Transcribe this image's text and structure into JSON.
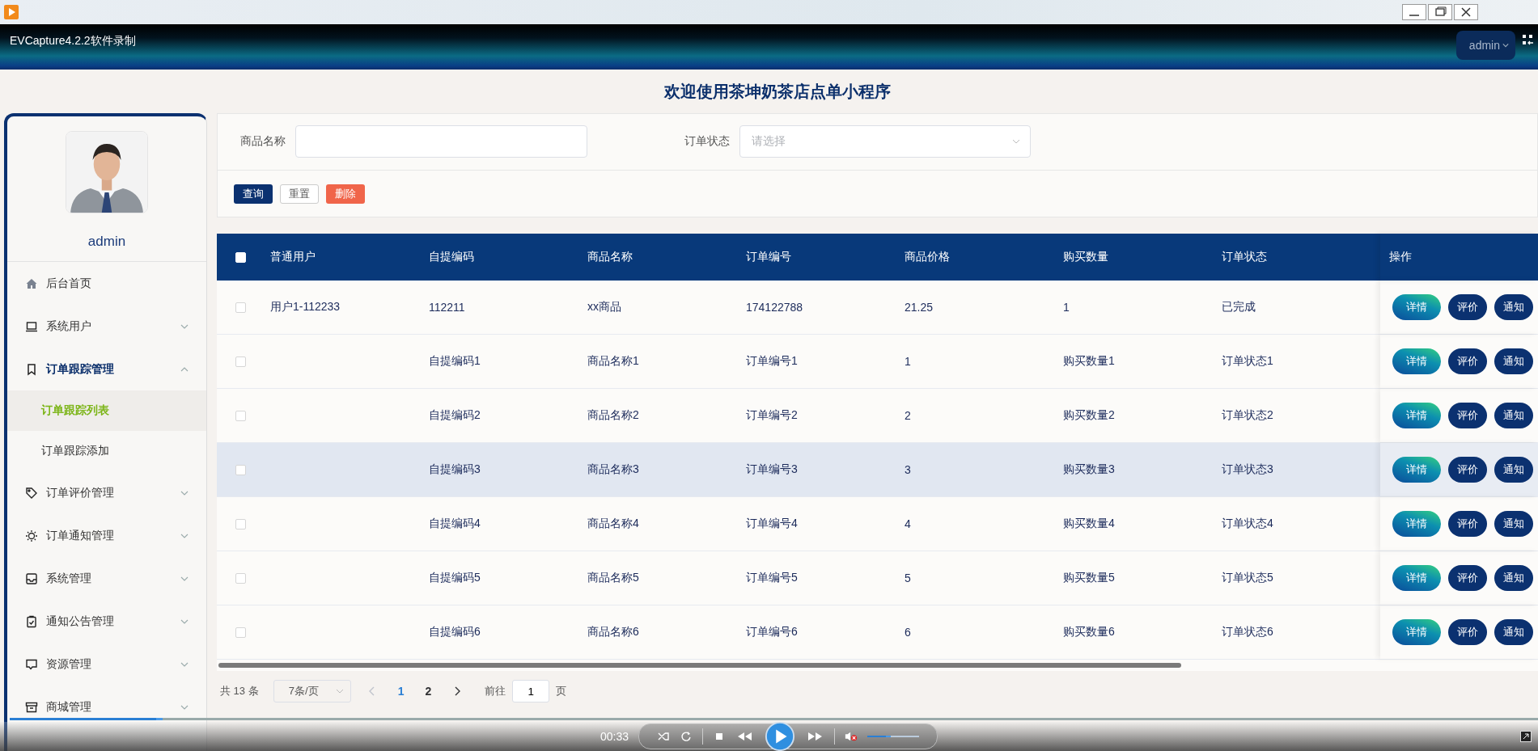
{
  "app_window": {
    "title": "EVCapture4.2.2软件录制"
  },
  "header": {
    "user_menu": "admin"
  },
  "page_title": "欢迎使用茶坤奶茶店点单小程序",
  "sidebar": {
    "username": "admin",
    "items": [
      {
        "label": "后台首页",
        "kind": "link",
        "selected": false
      },
      {
        "label": "系统用户",
        "kind": "group",
        "selected": false,
        "expanded": false
      },
      {
        "label": "订单跟踪管理",
        "kind": "group",
        "selected": true,
        "expanded": true,
        "children": [
          {
            "label": "订单跟踪列表",
            "selected": true
          },
          {
            "label": "订单跟踪添加",
            "selected": false
          }
        ]
      },
      {
        "label": "订单评价管理",
        "kind": "group",
        "selected": false,
        "expanded": false
      },
      {
        "label": "订单通知管理",
        "kind": "group",
        "selected": false,
        "expanded": false
      },
      {
        "label": "系统管理",
        "kind": "group",
        "selected": false,
        "expanded": false
      },
      {
        "label": "通知公告管理",
        "kind": "group",
        "selected": false,
        "expanded": false
      },
      {
        "label": "资源管理",
        "kind": "group",
        "selected": false,
        "expanded": false
      },
      {
        "label": "商城管理",
        "kind": "group",
        "selected": false,
        "expanded": false
      }
    ]
  },
  "filters": [
    {
      "label": "商品名称",
      "kind": "text"
    },
    {
      "label": "订单状态",
      "kind": "select",
      "placeholder": "请选择"
    }
  ],
  "filter_buttons": [
    {
      "label": "查询",
      "kind": "primary"
    },
    {
      "label": "重置",
      "kind": "plain"
    },
    {
      "label": "删除",
      "kind": "danger"
    }
  ],
  "table": {
    "select_all_checked": false,
    "columns": [
      "普通用户",
      "自提编码",
      "商品名称",
      "订单编号",
      "商品价格",
      "购买数量",
      "订单状态",
      "操作"
    ],
    "rows": [
      {
        "checked": false,
        "highlighted": false,
        "user": "用户1-112233",
        "pickup_code": "112211",
        "product_name": "xx商品",
        "order_no": "174122788",
        "price": "21.25",
        "quantity": "1",
        "status": "已完成",
        "actions": [
          {
            "label": "详情",
            "kind": "detail"
          },
          {
            "label": "评价",
            "kind": "plain"
          },
          {
            "label": "通知",
            "kind": "plain"
          }
        ]
      },
      {
        "checked": false,
        "highlighted": false,
        "pickup_code": "自提编码1",
        "product_name": "商品名称1",
        "order_no": "订单编号1",
        "price": "1",
        "quantity": "购买数量1",
        "status": "订单状态1",
        "actions": [
          {
            "label": "详情",
            "kind": "detail"
          },
          {
            "label": "评价",
            "kind": "plain"
          },
          {
            "label": "通知",
            "kind": "plain"
          }
        ]
      },
      {
        "checked": false,
        "highlighted": false,
        "pickup_code": "自提编码2",
        "product_name": "商品名称2",
        "order_no": "订单编号2",
        "price": "2",
        "quantity": "购买数量2",
        "status": "订单状态2",
        "actions": [
          {
            "label": "详情",
            "kind": "detail"
          },
          {
            "label": "评价",
            "kind": "plain"
          },
          {
            "label": "通知",
            "kind": "plain"
          }
        ]
      },
      {
        "checked": false,
        "highlighted": true,
        "pickup_code": "自提编码3",
        "product_name": "商品名称3",
        "order_no": "订单编号3",
        "price": "3",
        "quantity": "购买数量3",
        "status": "订单状态3",
        "actions": [
          {
            "label": "详情",
            "kind": "detail"
          },
          {
            "label": "评价",
            "kind": "plain"
          },
          {
            "label": "通知",
            "kind": "plain"
          }
        ]
      },
      {
        "checked": false,
        "highlighted": false,
        "pickup_code": "自提编码4",
        "product_name": "商品名称4",
        "order_no": "订单编号4",
        "price": "4",
        "quantity": "购买数量4",
        "status": "订单状态4",
        "actions": [
          {
            "label": "详情",
            "kind": "detail"
          },
          {
            "label": "评价",
            "kind": "plain"
          },
          {
            "label": "通知",
            "kind": "plain"
          }
        ]
      },
      {
        "checked": false,
        "highlighted": false,
        "pickup_code": "自提编码5",
        "product_name": "商品名称5",
        "order_no": "订单编号5",
        "price": "5",
        "quantity": "购买数量5",
        "status": "订单状态5",
        "actions": [
          {
            "label": "详情",
            "kind": "detail"
          },
          {
            "label": "评价",
            "kind": "plain"
          },
          {
            "label": "通知",
            "kind": "plain"
          }
        ]
      },
      {
        "checked": false,
        "highlighted": false,
        "pickup_code": "自提编码6",
        "product_name": "商品名称6",
        "order_no": "订单编号6",
        "price": "6",
        "quantity": "购买数量6",
        "status": "订单状态6",
        "actions": [
          {
            "label": "详情",
            "kind": "detail"
          },
          {
            "label": "评价",
            "kind": "plain"
          },
          {
            "label": "通知",
            "kind": "plain"
          }
        ]
      }
    ]
  },
  "pagination": {
    "total": "共 13 条",
    "page_size": "7条/页",
    "prev_disabled": true,
    "next_disabled": false,
    "pages": [
      {
        "label": "1",
        "selected": true
      },
      {
        "label": "2",
        "selected": false
      }
    ],
    "goto_label": "前往",
    "goto_value": "1",
    "goto_suffix": "页"
  },
  "player": {
    "time": "00:33",
    "muted": true,
    "progress": {
      "level": 0.1
    },
    "volume": {
      "level": 0.45
    }
  }
}
